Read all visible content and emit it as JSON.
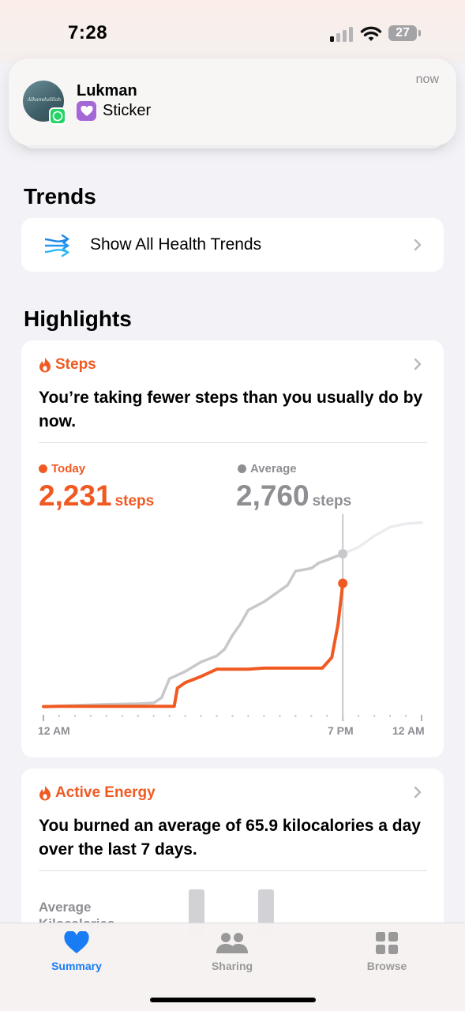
{
  "status": {
    "time": "7:28",
    "battery": "27"
  },
  "notification": {
    "app_icon": "whatsapp-icon",
    "avatar_text": "Alhamdulillah",
    "sender": "Lukman",
    "message": "Sticker",
    "time": "now"
  },
  "trends": {
    "title": "Trends",
    "row_label": "Show All Health Trends",
    "icon": "trends-arrows-icon"
  },
  "highlights": {
    "title": "Highlights",
    "steps": {
      "heading": "Steps",
      "text": "You’re taking fewer steps than you usually do by now.",
      "today_label": "Today",
      "today_value": "2,231",
      "today_unit": "steps",
      "average_label": "Average",
      "average_value": "2,760",
      "average_unit": "steps",
      "colors": {
        "today": "#f05a22",
        "average": "#8e8e93",
        "future": "#ececf0"
      }
    },
    "energy": {
      "heading": "Active Energy",
      "text": "You burned an average of 65.9 kilocalories a day over the last 7 days.",
      "avg_label": "Average Kilocalories"
    }
  },
  "chart_data": {
    "type": "line",
    "x_tick_labels": [
      "12 AM",
      "7 PM",
      "12 AM"
    ],
    "xlim": [
      0,
      24
    ],
    "ylim": [
      0,
      3400
    ],
    "current_hour": 19.0,
    "series": [
      {
        "name": "Today",
        "color": "#f05a22",
        "x": [
          0,
          1,
          4,
          7,
          8.3,
          8.5,
          9,
          10,
          11,
          12,
          13,
          14,
          15,
          16,
          17,
          17.7,
          18.3,
          18.7,
          19.0
        ],
        "y": [
          20,
          25,
          25,
          25,
          25,
          350,
          450,
          560,
          690,
          690,
          690,
          710,
          710,
          710,
          710,
          710,
          900,
          1500,
          2231
        ]
      },
      {
        "name": "Average",
        "color": "#c8c8cc",
        "x": [
          0,
          2,
          4,
          6,
          7,
          7.5,
          8,
          9,
          10,
          11,
          11.5,
          12,
          12.5,
          13,
          14,
          15,
          15.5,
          16,
          17,
          17.5,
          18,
          19.0
        ],
        "y": [
          20,
          40,
          60,
          70,
          85,
          180,
          520,
          650,
          820,
          930,
          1050,
          1300,
          1500,
          1750,
          1900,
          2100,
          2200,
          2450,
          2500,
          2600,
          2650,
          2760
        ]
      },
      {
        "name": "Average (remaining)",
        "color": "#ececf0",
        "x": [
          19.0,
          20,
          21,
          22,
          23,
          24
        ],
        "y": [
          2760,
          2880,
          3080,
          3240,
          3300,
          3320
        ]
      }
    ]
  },
  "tabs": [
    {
      "label": "Summary",
      "icon": "heart-icon",
      "active": true
    },
    {
      "label": "Sharing",
      "icon": "people-icon",
      "active": false
    },
    {
      "label": "Browse",
      "icon": "grid-icon",
      "active": false
    }
  ]
}
